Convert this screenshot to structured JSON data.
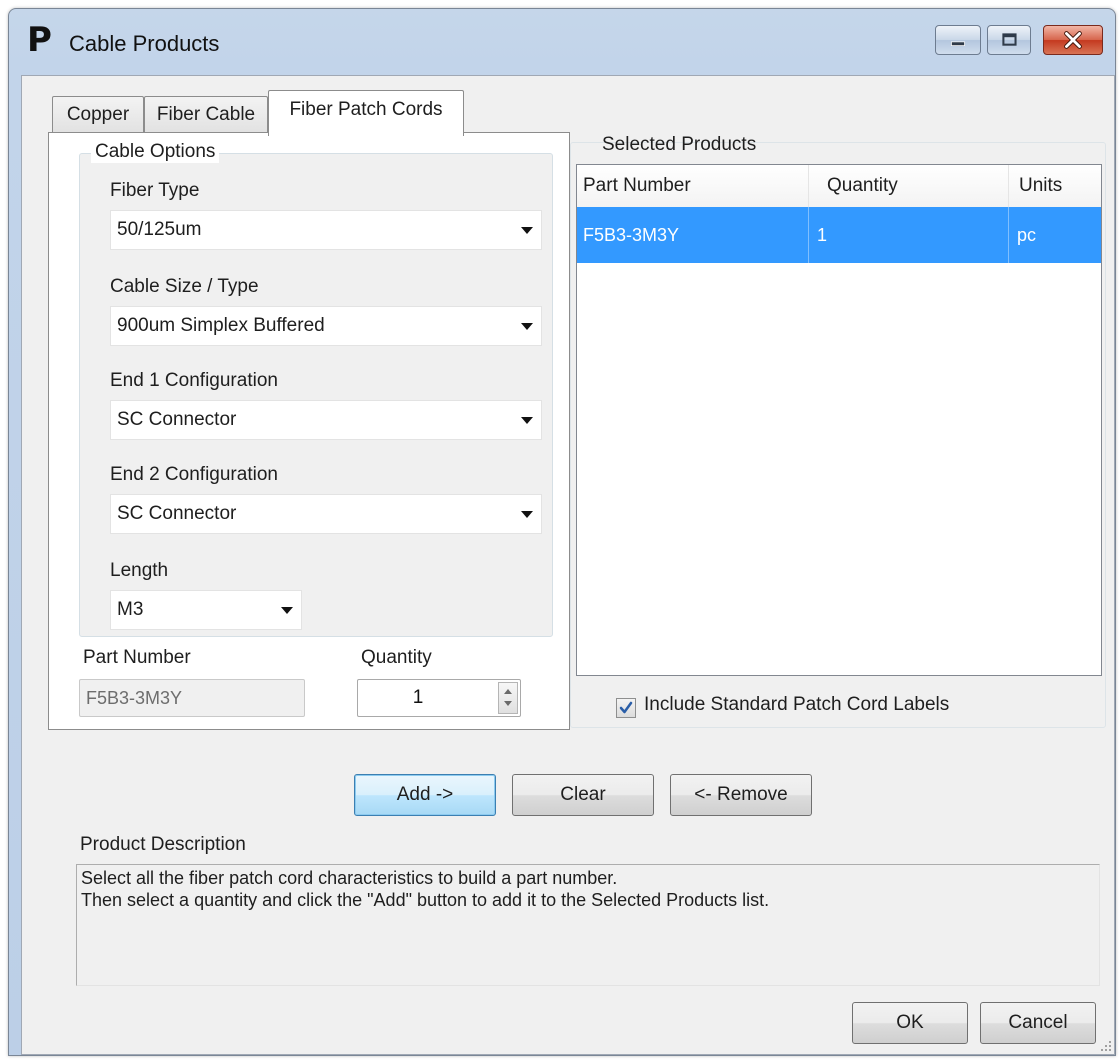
{
  "window": {
    "title": "Cable Products",
    "logo_letter": "P"
  },
  "tabs": [
    {
      "label": "Copper",
      "active": false
    },
    {
      "label": "Fiber Cable",
      "active": false
    },
    {
      "label": "Fiber Patch Cords",
      "active": true
    }
  ],
  "cable_options": {
    "title": "Cable Options",
    "fiber_type": {
      "label": "Fiber Type",
      "value": "50/125um"
    },
    "cable_size": {
      "label": "Cable Size / Type",
      "value": "900um Simplex Buffered"
    },
    "end1": {
      "label": "End 1 Configuration",
      "value": "SC Connector"
    },
    "end2": {
      "label": "End 2 Configuration",
      "value": "SC Connector"
    },
    "length": {
      "label": "Length",
      "value": "M3"
    }
  },
  "part_number": {
    "label": "Part Number",
    "value": "F5B3-3M3Y"
  },
  "quantity": {
    "label": "Quantity",
    "value": "1"
  },
  "selected_products": {
    "title": "Selected Products",
    "columns": [
      "Part Number",
      "Quantity",
      "Units"
    ],
    "rows": [
      {
        "part_number": "F5B3-3M3Y",
        "quantity": "1",
        "units": "pc",
        "selected": true
      }
    ],
    "include_labels": {
      "label": "Include Standard Patch Cord Labels",
      "checked": true
    }
  },
  "actions": {
    "add": "Add ->",
    "clear": "Clear",
    "remove": "<- Remove"
  },
  "product_description": {
    "label": "Product Description",
    "lines": [
      "Select all the fiber patch cord characteristics to build a part number.",
      "Then select a quantity and click the \"Add\" button to add it to the Selected Products list."
    ]
  },
  "dialog_buttons": {
    "ok": "OK",
    "cancel": "Cancel"
  },
  "colors": {
    "selection": "#3399ff",
    "title_bar": "#c2d4ea",
    "close_button": "#c4391f"
  }
}
